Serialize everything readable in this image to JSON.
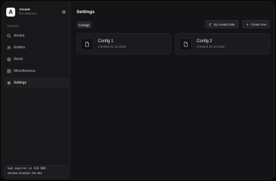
{
  "sidebar": {
    "brand": {
      "logo_letter": "A",
      "name": "Arcane",
      "subtitle": "For Unturned"
    },
    "section_label": "Category",
    "items": [
      {
        "label": "Aimbot",
        "icon": "search-icon"
      },
      {
        "label": "Entities",
        "icon": "users-icon"
      },
      {
        "label": "World",
        "icon": "globe-icon"
      },
      {
        "label": "Miscellaneous",
        "icon": "grid-icon"
      },
      {
        "label": "Settings",
        "icon": "gear-icon",
        "active": true
      }
    ],
    "footer": {
      "subscription": "Sub expires in 42d 00h",
      "session": "Session duration: 2m 43s"
    }
  },
  "main": {
    "title": "Settings",
    "chip": "Configs",
    "toolbar": {
      "sort_label": "By created date",
      "create_label": "Create new"
    },
    "cards": [
      {
        "title": "Config 1",
        "subtitle": "Created 21.10.2025",
        "icon": "file-icon"
      },
      {
        "title": "Config 2",
        "subtitle": "Created 29.10.2025",
        "icon": "file-icon"
      }
    ]
  },
  "colors": {
    "background": "#141416",
    "sidebar": "#18181a",
    "card": "#1b1b1e",
    "accent": "#f2f2f2"
  }
}
